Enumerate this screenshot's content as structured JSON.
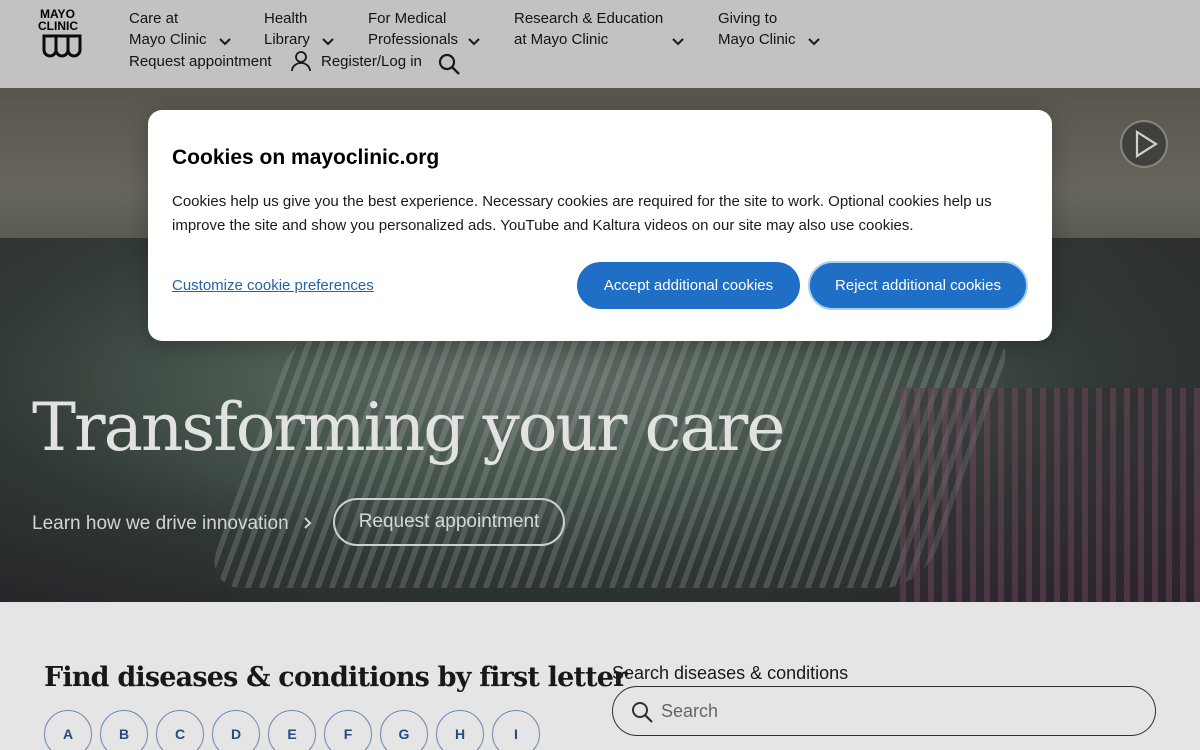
{
  "header": {
    "logo_line1": "MAYO",
    "logo_line2": "CLINIC",
    "nav": [
      {
        "line1": "Care at",
        "line2": "Mayo Clinic"
      },
      {
        "line1": "Health",
        "line2": "Library"
      },
      {
        "line1": "For Medical",
        "line2": "Professionals"
      },
      {
        "line1": "Research & Education",
        "line2": "at Mayo Clinic"
      },
      {
        "line1": "Giving to",
        "line2": "Mayo Clinic"
      }
    ],
    "request_appointment": "Request appointment",
    "register_login": "Register/Log in"
  },
  "hero": {
    "title": "Transforming your care",
    "learn_link": "Learn how we drive innovation",
    "request_button": "Request appointment"
  },
  "find": {
    "title": "Find diseases & conditions by first letter",
    "letters": [
      "A",
      "B",
      "C",
      "D",
      "E",
      "F",
      "G",
      "H",
      "I"
    ],
    "search_label": "Search diseases & conditions",
    "search_placeholder": "Search"
  },
  "cookie_modal": {
    "title": "Cookies on mayoclinic.org",
    "body": "Cookies help us give you the best experience. Necessary cookies are required for the site to work. Optional cookies help us improve the site and show you personalized ads. YouTube and Kaltura videos on our site may also use cookies.",
    "customize_link": "Customize cookie preferences",
    "accept_button": "Accept additional cookies",
    "reject_button": "Reject additional cookies"
  },
  "colors": {
    "primary_button": "#1f6fc7",
    "link": "#2563a8",
    "letter_text": "#2a4e86"
  }
}
